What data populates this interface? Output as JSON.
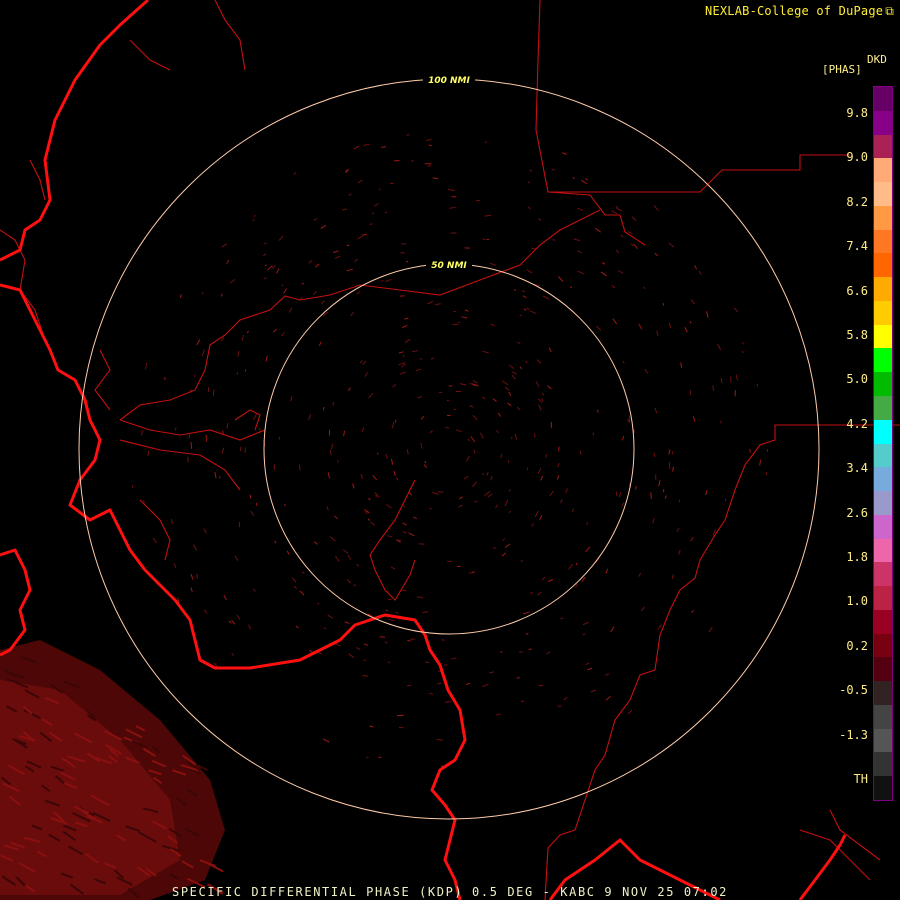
{
  "credit": {
    "text": "NEXLAB-College of DuPage",
    "icon": "external-link-icon"
  },
  "legend": {
    "unit_code": "DKD",
    "unit_name": "[PHAS]",
    "labels": [
      "9.8",
      "9.0",
      "8.2",
      "7.4",
      "6.6",
      "5.8",
      "5.0",
      "4.2",
      "3.4",
      "2.6",
      "1.8",
      "1.0",
      "0.2",
      "-0.5",
      "-1.3",
      "TH"
    ],
    "colors": [
      "#660066",
      "#880088",
      "#aa2255",
      "#ffaa77",
      "#ffbb88",
      "#ff9944",
      "#ff7722",
      "#ff6600",
      "#ffaa00",
      "#ffcc00",
      "#ffff00",
      "#00ff00",
      "#00bb00",
      "#44aa44",
      "#00ffff",
      "#55cccc",
      "#77aadd",
      "#9999cc",
      "#cc66cc",
      "#ee66aa",
      "#cc3366",
      "#bb2244",
      "#990022",
      "#770011",
      "#550011",
      "#332222",
      "#444444",
      "#555555",
      "#333333",
      "#111111"
    ]
  },
  "rings": {
    "inner_label": "50 NMI",
    "outer_label": "100 NMI"
  },
  "footer": {
    "text": "SPECIFIC DIFFERENTIAL PHASE (KDP) 0.5 DEG - KABC 9 NOV 25 07:02"
  },
  "colors": {
    "background": "#000000",
    "coastline": "#ff1010",
    "boundary": "#cc1010",
    "ring": "#ffccaa",
    "clutter": "#7a0f0f",
    "label": "#ffff66"
  }
}
